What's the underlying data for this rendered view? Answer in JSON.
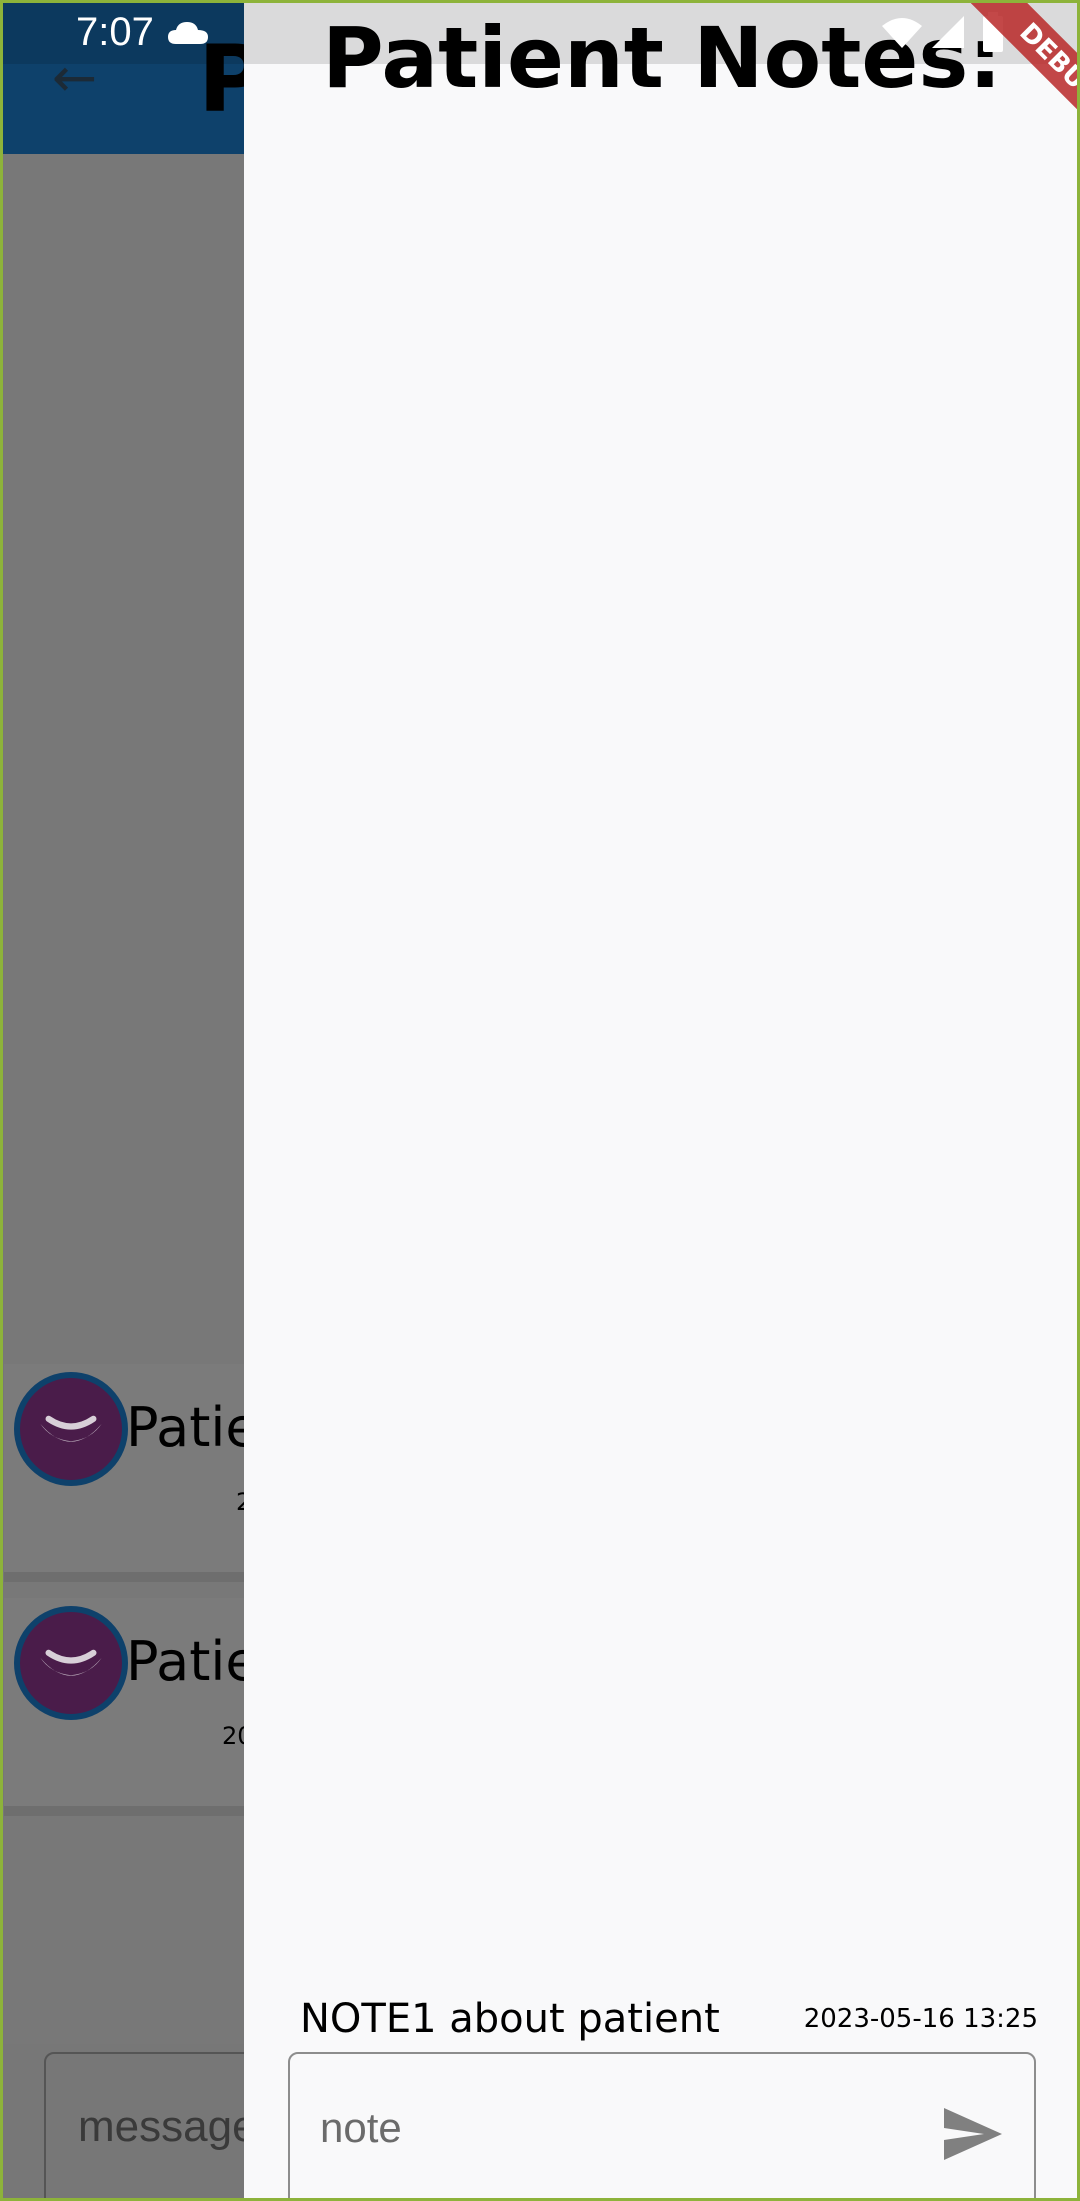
{
  "status_bar": {
    "time": "7:07",
    "icons": [
      "cloud-icon",
      "wifi-icon",
      "signal-icon",
      "battery-icon"
    ]
  },
  "background_screen": {
    "title": "P",
    "back_icon": "arrow-left-icon",
    "patients": [
      {
        "name": "Patie",
        "date": "2"
      },
      {
        "name": "Patie",
        "date": "20"
      }
    ],
    "message_placeholder": "message"
  },
  "drawer": {
    "title": "Patient Notes:",
    "notes": [
      {
        "text": "NOTE1 about patient",
        "timestamp": "2023-05-16 13:25"
      }
    ],
    "input_placeholder": "note",
    "send_icon": "send-icon"
  },
  "debug_banner": "DEBUG",
  "colors": {
    "app_bar": "#0E416B",
    "drawer_bg": "#F9F9FA",
    "scrim": "#777777",
    "frame": "#8DB33A",
    "avatar_bg": "#4a1c4a",
    "debug_ribbon": "#B82828"
  }
}
